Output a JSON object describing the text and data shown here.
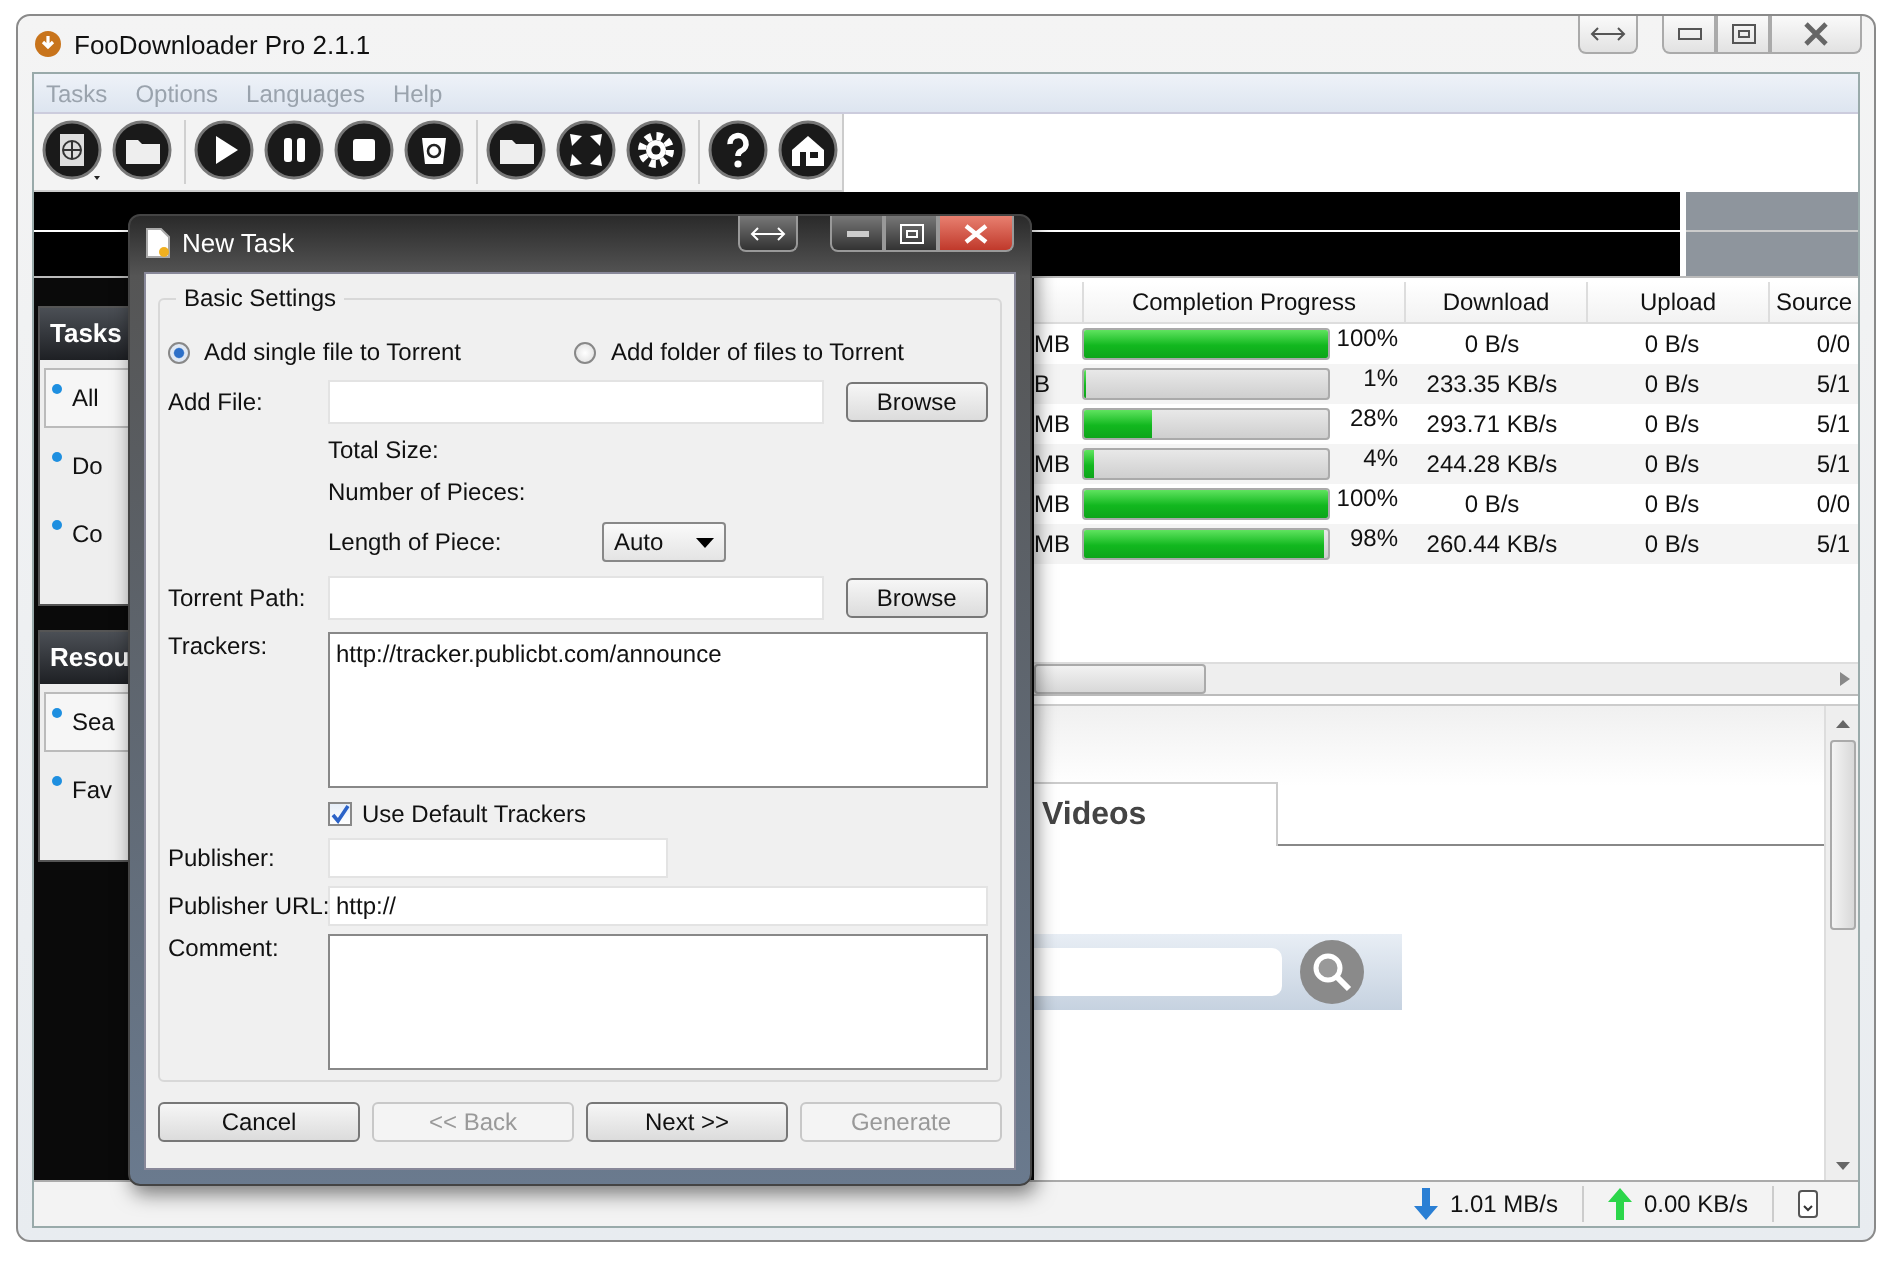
{
  "window": {
    "title": "FooDownloader Pro 2.1.1"
  },
  "menu": [
    "Tasks",
    "Options",
    "Languages",
    "Help"
  ],
  "sidebar": [
    {
      "heading": "Tasks",
      "items": [
        {
          "label": "All",
          "selected": true
        },
        {
          "label": "Do",
          "selected": false
        },
        {
          "label": "Co",
          "selected": false
        }
      ]
    },
    {
      "heading": "Resou",
      "items": [
        {
          "label": "Sea",
          "selected": true
        },
        {
          "label": "Fav",
          "selected": false
        }
      ]
    }
  ],
  "table": {
    "columns": [
      "Completion Progress",
      "Download",
      "Upload",
      "Source"
    ],
    "rows": [
      {
        "size": "MB",
        "level": 1,
        "percent": "100%",
        "download": "0 B/s",
        "upload": "0 B/s",
        "sources": "0/0"
      },
      {
        "size": "B",
        "level": 0.01,
        "percent": "1%",
        "download": "233.35 KB/s",
        "upload": "0 B/s",
        "sources": "5/1"
      },
      {
        "size": "MB",
        "level": 0.28,
        "percent": "28%",
        "download": "293.71 KB/s",
        "upload": "0 B/s",
        "sources": "5/1"
      },
      {
        "size": "MB",
        "level": 0.04,
        "percent": "4%",
        "download": "244.28 KB/s",
        "upload": "0 B/s",
        "sources": "5/1"
      },
      {
        "size": "MB",
        "level": 1,
        "percent": "100%",
        "download": "0 B/s",
        "upload": "0 B/s",
        "sources": "0/0"
      },
      {
        "size": "MB",
        "level": 0.98,
        "percent": "98%",
        "download": "260.44 KB/s",
        "upload": "0 B/s",
        "sources": "5/1"
      }
    ]
  },
  "browser": {
    "tab": "Videos"
  },
  "status_bar": {
    "download": "1.01 MB/s",
    "upload": "0.00 KB/s"
  },
  "dialog": {
    "title": "New Task",
    "group": "Basic Settings",
    "modes": [
      {
        "label": "Add single file to Torrent",
        "selected": true
      },
      {
        "label": "Add folder of files to Torrent",
        "selected": false
      }
    ],
    "add_file": {
      "label": "Add File:",
      "button": "Browse"
    },
    "info": [
      "Total Size:",
      "Number of Pieces:"
    ],
    "piece_length": {
      "label": "Length of Piece:",
      "value": "Auto"
    },
    "torrent_path": {
      "label": "Torrent Path:",
      "button": "Browse"
    },
    "trackers": {
      "label": "Trackers:",
      "value": "http://tracker.publicbt.com/announce"
    },
    "default_trackers": {
      "label": "Use Default Trackers",
      "checked": true
    },
    "publisher": {
      "label": "Publisher:"
    },
    "publisher_url": {
      "label": "Publisher URL:",
      "value": "http://"
    },
    "comment": {
      "label": "Comment:"
    },
    "buttons": [
      {
        "label": "Cancel",
        "disabled": false
      },
      {
        "label": "<< Back",
        "disabled": true
      },
      {
        "label": "Next >>",
        "disabled": false
      },
      {
        "label": "Generate",
        "disabled": true
      }
    ]
  }
}
